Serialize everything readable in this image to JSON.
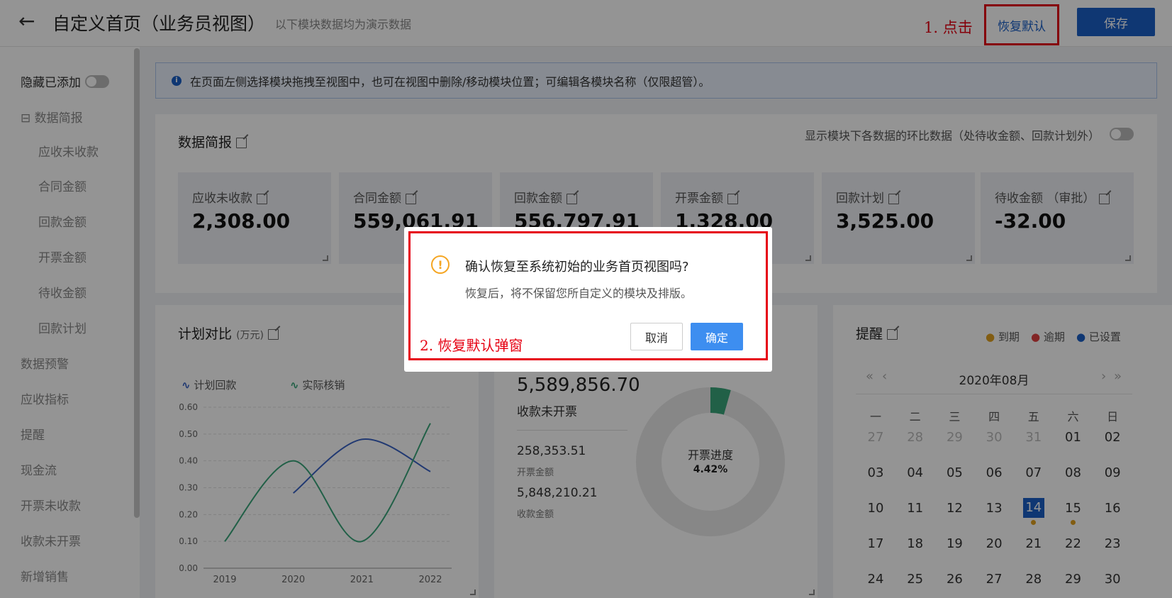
{
  "header": {
    "title": "自定义首页（业务员视图）",
    "subtitle": "以下模块数据均为演示数据",
    "annotation": "1. 点击",
    "restore_label": "恢复默认",
    "save_label": "保存"
  },
  "sidebar": {
    "toggle_label": "隐藏已添加",
    "group_label": "⊟ 数据简报",
    "sub_items": [
      "应收未收款",
      "合同金额",
      "回款金额",
      "开票金额",
      "待收金额",
      "回款计划"
    ],
    "items": [
      "数据预警",
      "应收指标",
      "提醒",
      "现金流",
      "开票未收款",
      "收款未开票",
      "新增销售"
    ]
  },
  "notice": {
    "icon": "info-icon",
    "text": "在页面左侧选择模块拖拽至视图中，也可在视图中删除/移动模块位置；可编辑各模块名称（仅限超管）。"
  },
  "brief": {
    "title": "数据简报",
    "toggle_text": "显示模块下各数据的环比数据（处待收金额、回款计划外）",
    "stats": [
      {
        "label": "应收未收款",
        "value": "2,308.00"
      },
      {
        "label": "合同金额",
        "value": "559,061.91"
      },
      {
        "label": "回款金额",
        "value": "556,797.91"
      },
      {
        "label": "开票金额",
        "value": "1,328.00"
      },
      {
        "label": "回款计划",
        "value": "3,525.00"
      },
      {
        "label": "待收金额 （审批）",
        "value": "-32.00"
      }
    ]
  },
  "plan": {
    "title": "计划对比",
    "unit": "(万元)",
    "legend": [
      "计划回款",
      "实际核销"
    ]
  },
  "chart_data": {
    "type": "line",
    "x": [
      "2019",
      "2020",
      "2021",
      "2022"
    ],
    "ylim": [
      0,
      0.6
    ],
    "yticks": [
      "0.00",
      "0.10",
      "0.20",
      "0.30",
      "0.40",
      "0.50",
      "0.60"
    ],
    "series": [
      {
        "name": "计划回款",
        "color": "#3a63c4",
        "values": [
          null,
          0.28,
          0.48,
          0.36
        ]
      },
      {
        "name": "实际核销",
        "color": "#3aa57a",
        "values": [
          0.1,
          0.4,
          0.1,
          0.54
        ]
      }
    ],
    "grid": true
  },
  "invoice": {
    "big_value": "5,589,856.70",
    "big_label": "收款未开票",
    "rows": [
      {
        "value": "258,353.51",
        "label": "开票金额"
      },
      {
        "value": "5,848,210.21",
        "label": "收款金额"
      }
    ],
    "donut_label": "开票进度",
    "donut_value": "4.42%",
    "donut_fraction": 0.0442
  },
  "reminder": {
    "title": "提醒",
    "legend": [
      {
        "label": "到期",
        "color": "#e0a020"
      },
      {
        "label": "逾期",
        "color": "#e04040"
      },
      {
        "label": "已设置",
        "color": "#1a5fc7"
      }
    ],
    "month": "2020年08月",
    "weekdays": [
      "一",
      "二",
      "三",
      "四",
      "五",
      "六",
      "日"
    ],
    "days": [
      [
        "27",
        "28",
        "29",
        "30",
        "31",
        "01",
        "02"
      ],
      [
        "03",
        "04",
        "05",
        "06",
        "07",
        "08",
        "09"
      ],
      [
        "10",
        "11",
        "12",
        "13",
        "14",
        "15",
        "16"
      ],
      [
        "17",
        "18",
        "19",
        "20",
        "21",
        "22",
        "23"
      ],
      [
        "24",
        "25",
        "26",
        "27",
        "28",
        "29",
        "30"
      ]
    ],
    "today": "14"
  },
  "dialog": {
    "title": "确认恢复至系统初始的业务首页视图吗?",
    "desc": "恢复后，将不保留您所自定义的模块及排版。",
    "annotation": "2. 恢复默认弹窗",
    "cancel_label": "取消",
    "ok_label": "确定"
  }
}
